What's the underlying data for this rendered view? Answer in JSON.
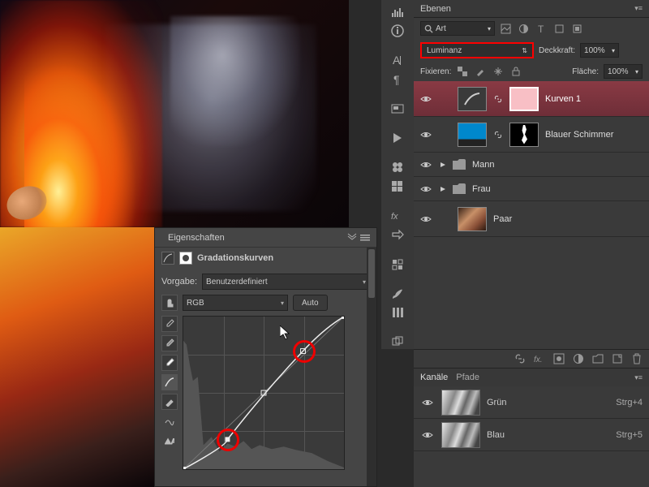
{
  "panels": {
    "layers": {
      "title": "Ebenen",
      "filter_label": "Art",
      "blend_mode": "Luminanz",
      "opacity_label": "Deckkraft:",
      "opacity_value": "100%",
      "fill_label": "Fläche:",
      "fill_value": "100%",
      "lock_label": "Fixieren:",
      "layers": [
        {
          "name": "Kurven 1"
        },
        {
          "name": "Blauer Schimmer"
        },
        {
          "name": "Mann"
        },
        {
          "name": "Frau"
        },
        {
          "name": "Paar"
        }
      ]
    },
    "properties": {
      "title": "Eigenschaften",
      "subtitle": "Gradationskurven",
      "preset_label": "Vorgabe:",
      "preset_value": "Benutzerdefiniert",
      "channel_value": "RGB",
      "auto_label": "Auto"
    },
    "channels": {
      "tab1": "Kanäle",
      "tab2": "Pfade",
      "rows": [
        {
          "name": "Grün",
          "shortcut": "Strg+4"
        },
        {
          "name": "Blau",
          "shortcut": "Strg+5"
        }
      ]
    }
  },
  "chart_data": {
    "type": "line",
    "title": "Gradationskurven",
    "xlabel": "",
    "ylabel": "",
    "xlim": [
      0,
      255
    ],
    "ylim": [
      0,
      255
    ],
    "points": [
      {
        "x": 0,
        "y": 0
      },
      {
        "x": 70,
        "y": 50
      },
      {
        "x": 128,
        "y": 128
      },
      {
        "x": 190,
        "y": 198
      },
      {
        "x": 255,
        "y": 255
      }
    ],
    "highlighted_points": [
      {
        "x": 70,
        "y": 50
      },
      {
        "x": 190,
        "y": 198
      }
    ],
    "cursor": {
      "x": 155,
      "y": 220
    }
  }
}
